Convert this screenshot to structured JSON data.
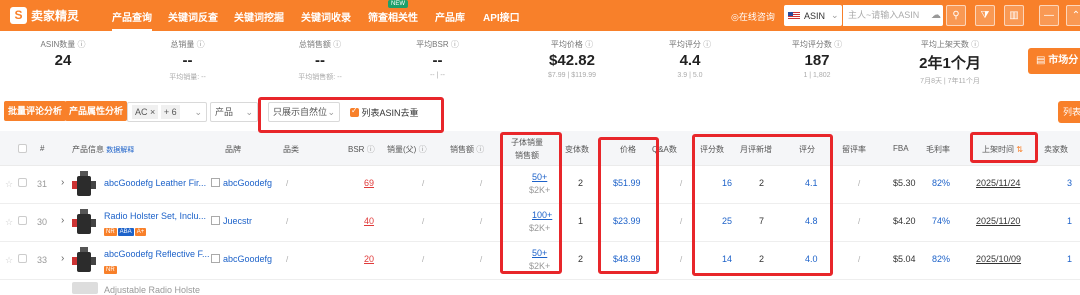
{
  "app": {
    "logo_text": "卖家精灵",
    "logo_mark": "S"
  },
  "nav": {
    "items": [
      "产品查询",
      "关键词反查",
      "关键词挖掘",
      "关键词收录",
      "筛查相关性",
      "产品库",
      "API接口"
    ],
    "new_badge": "NEW",
    "consult": "在线咨询",
    "asin_select": "ASIN",
    "search_placeholder": "主人~请输入ASIN"
  },
  "stats": [
    {
      "label": "ASIN数量",
      "value": "24",
      "sub": ""
    },
    {
      "label": "总销量",
      "value": "--",
      "sub": "平均销量: --"
    },
    {
      "label": "总销售额",
      "value": "--",
      "sub": "平均销售额: --"
    },
    {
      "label": "平均BSR",
      "value": "--",
      "sub": "-- | --"
    },
    {
      "label": "平均价格",
      "value": "$42.82",
      "sub": "$7.99 | $119.99"
    },
    {
      "label": "平均评分",
      "value": "4.4",
      "sub": "3.9 | 5.0"
    },
    {
      "label": "平均评分数",
      "value": "187",
      "sub": "1 | 1,802"
    },
    {
      "label": "平均上架天数",
      "value": "2年1个月",
      "sub": "7月8天 | 7年11个月"
    }
  ],
  "market_button": "市场分",
  "toolbar": {
    "btn_review": "批量评论分析",
    "btn_attr": "产品属性分析",
    "tag": "AC",
    "tag_more": "+ 6",
    "product_select": "产品",
    "natural_only": "只展示自然位",
    "dedupe": "列表ASIN去重",
    "list_button": "列表"
  },
  "columns": {
    "index": "#",
    "product": "产品信息",
    "product_link": "数据解释",
    "brand": "品牌",
    "category": "品类",
    "bsr": "BSR",
    "sales_parent": "销量(父)",
    "revenue": "销售额",
    "child_sales": "子体销量",
    "child_revenue": "销售额",
    "variants": "变体数",
    "price": "价格",
    "qa": "Q&A数",
    "ratings": "评分数",
    "monthly_new": "月评新增",
    "rating": "评分",
    "review_rate": "留评率",
    "fba": "FBA",
    "margin": "毛利率",
    "launch": "上架时间",
    "sellers": "卖家数"
  },
  "rows": [
    {
      "index": "31",
      "title": "abcGoodefg Leather Fir...",
      "brand": "abcGoodefg",
      "category": "/",
      "bsr": "69",
      "sales_parent": "/",
      "revenue": "/",
      "child_sales": "50+",
      "child_revenue": "$2K+",
      "variants": "2",
      "price": "$51.99",
      "qa": "/",
      "ratings": "16",
      "monthly_new": "2",
      "rating": "4.1",
      "review_rate": "/",
      "fba": "$5.30",
      "margin": "82%",
      "launch": "2025/11/24",
      "sellers": "3",
      "badges": []
    },
    {
      "index": "30",
      "title": "Radio Holster Set, Inclu...",
      "brand": "Juecstr",
      "category": "/",
      "bsr": "40",
      "sales_parent": "/",
      "revenue": "/",
      "child_sales": "100+",
      "child_revenue": "$2K+",
      "variants": "1",
      "price": "$23.99",
      "qa": "/",
      "ratings": "25",
      "monthly_new": "7",
      "rating": "4.8",
      "review_rate": "/",
      "fba": "$4.20",
      "margin": "74%",
      "launch": "2025/11/20",
      "sellers": "1",
      "badges": [
        "NR",
        "ABA",
        "A+"
      ]
    },
    {
      "index": "33",
      "title": "abcGoodefg Reflective F...",
      "brand": "abcGoodefg",
      "category": "/",
      "bsr": "20",
      "sales_parent": "/",
      "revenue": "/",
      "child_sales": "50+",
      "child_revenue": "$2K+",
      "variants": "2",
      "price": "$48.99",
      "qa": "/",
      "ratings": "14",
      "monthly_new": "2",
      "rating": "4.0",
      "review_rate": "/",
      "fba": "$5.04",
      "margin": "82%",
      "launch": "2025/10/09",
      "sellers": "1",
      "badges": [
        "NR"
      ]
    }
  ],
  "partial_row_title": "Adjustable Radio Holste",
  "colors": {
    "accent": "#f8802a",
    "annotation": "#e8262a",
    "link": "#1d62c9",
    "bsr": "#e03a3a"
  }
}
